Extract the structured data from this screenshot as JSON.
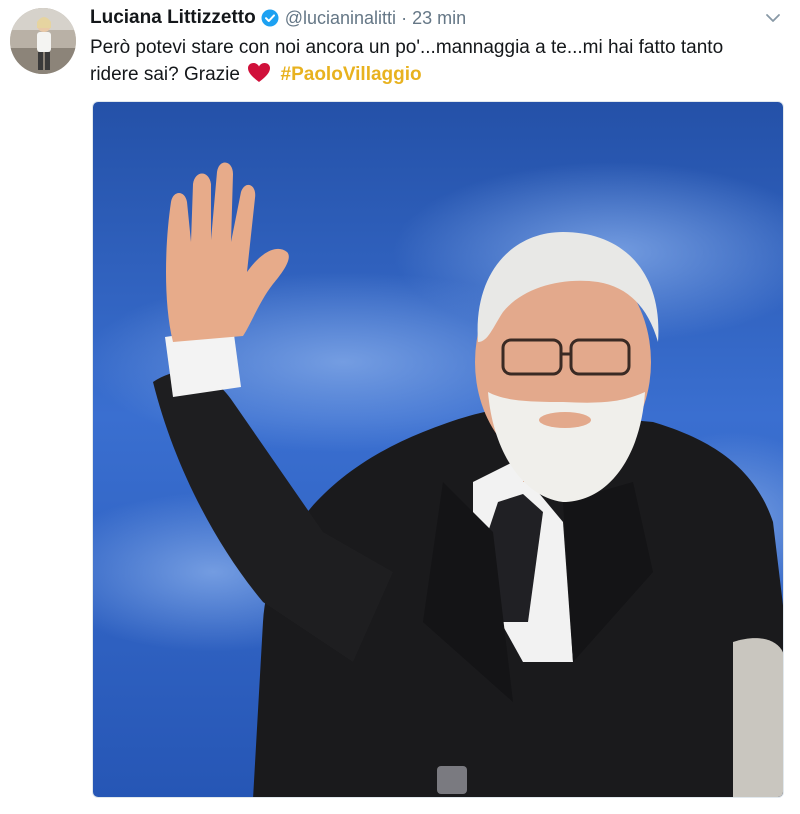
{
  "tweet": {
    "author": {
      "display_name": "Luciana Littizzetto",
      "handle": "@lucianinalitti",
      "verified": true,
      "avatar_icon": "profile-photo"
    },
    "separator": "·",
    "timestamp": "23 min",
    "text_line1": "Però potevi stare con noi ancora un po'...mannaggia a te...mi hai fatto tanto",
    "text_line2": "ridere sai? Grazie",
    "emoji": "red-heart",
    "hashtag": "#PaoloVillaggio",
    "media": {
      "type": "photo",
      "icon": "photo"
    },
    "menu_icon": "chevron-down-icon"
  },
  "colors": {
    "hashtag": "#e8b21f",
    "heart": "#d0103a",
    "verified": "#1da1f2",
    "secondary_text": "#657786",
    "photo_background": "#2f63c4"
  }
}
